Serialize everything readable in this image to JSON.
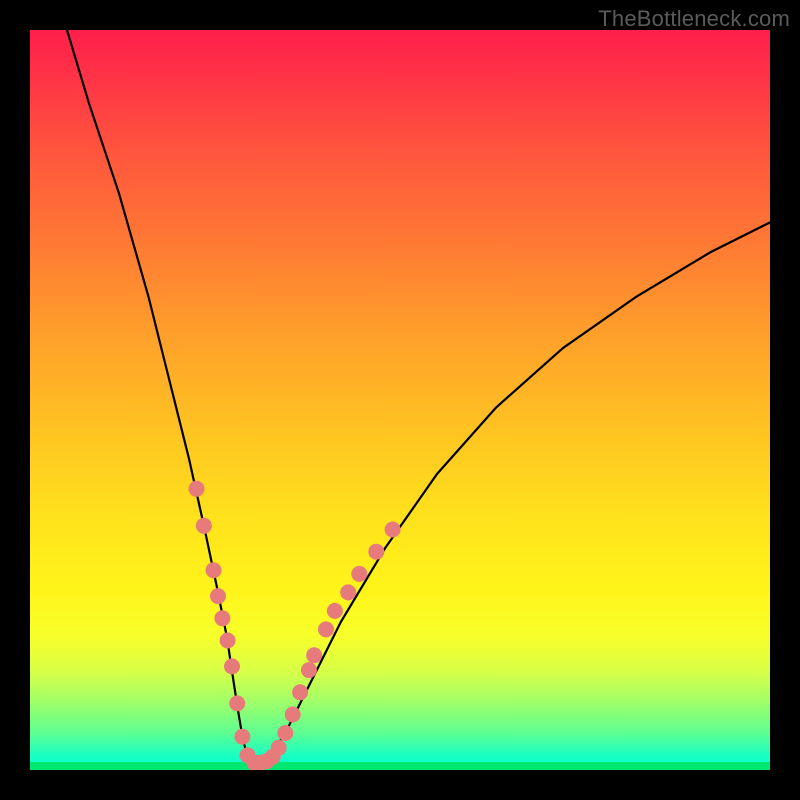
{
  "watermark": "TheBottleneck.com",
  "chart_data": {
    "type": "line",
    "title": "",
    "xlabel": "",
    "ylabel": "",
    "xlim": [
      0,
      100
    ],
    "ylim": [
      0,
      100
    ],
    "grid": false,
    "legend": false,
    "series": [
      {
        "name": "bottleneck-curve",
        "color": "#000000",
        "x": [
          5,
          8,
          12,
          16,
          19,
          21.5,
          23.5,
          25.2,
          26.6,
          27.5,
          28.2,
          28.8,
          29.5,
          30.4,
          31.5,
          33,
          35,
          38,
          42,
          48,
          55,
          63,
          72,
          82,
          92,
          100
        ],
        "y": [
          100,
          90,
          78,
          64,
          52,
          42,
          33,
          25,
          18,
          12,
          7.5,
          4,
          1.5,
          1,
          1.2,
          2.5,
          6,
          12,
          20,
          30,
          40,
          49,
          57,
          64,
          70,
          74
        ]
      }
    ],
    "markers": [
      {
        "name": "highlight-points",
        "color": "#e77b7b",
        "shape": "circle",
        "radius_px": 8,
        "points": [
          {
            "x": 22.5,
            "y": 38
          },
          {
            "x": 23.5,
            "y": 33
          },
          {
            "x": 24.8,
            "y": 27
          },
          {
            "x": 25.4,
            "y": 23.5
          },
          {
            "x": 26.0,
            "y": 20.5
          },
          {
            "x": 26.7,
            "y": 17.5
          },
          {
            "x": 27.3,
            "y": 14
          },
          {
            "x": 28.0,
            "y": 9
          },
          {
            "x": 28.7,
            "y": 4.5
          },
          {
            "x": 29.4,
            "y": 2
          },
          {
            "x": 30.3,
            "y": 1
          },
          {
            "x": 31.2,
            "y": 1
          },
          {
            "x": 32.0,
            "y": 1.2
          },
          {
            "x": 32.8,
            "y": 1.8
          },
          {
            "x": 33.6,
            "y": 3
          },
          {
            "x": 34.5,
            "y": 5
          },
          {
            "x": 35.5,
            "y": 7.5
          },
          {
            "x": 36.5,
            "y": 10.5
          },
          {
            "x": 37.7,
            "y": 13.5
          },
          {
            "x": 38.4,
            "y": 15.5
          },
          {
            "x": 40.0,
            "y": 19
          },
          {
            "x": 41.2,
            "y": 21.5
          },
          {
            "x": 43.0,
            "y": 24
          },
          {
            "x": 44.5,
            "y": 26.5
          },
          {
            "x": 46.8,
            "y": 29.5
          },
          {
            "x": 49.0,
            "y": 32.5
          }
        ]
      }
    ]
  }
}
